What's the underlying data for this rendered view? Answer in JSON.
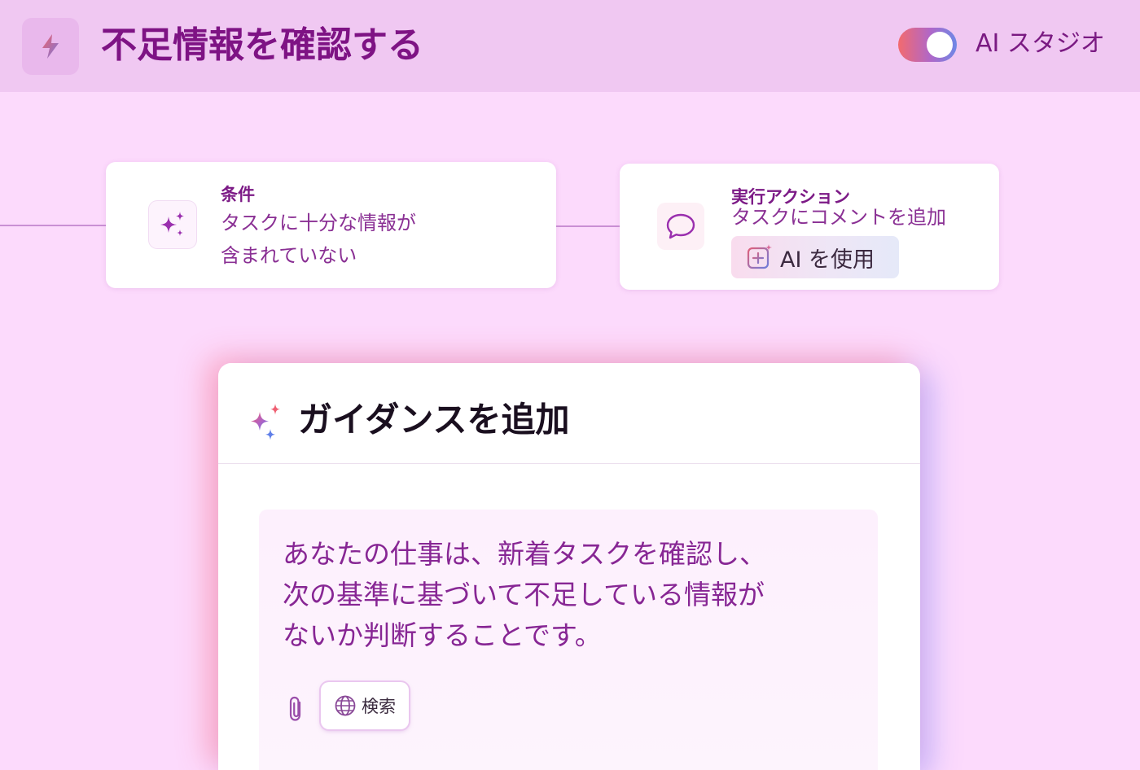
{
  "header": {
    "title": "不足情報を確認する",
    "app_icon": "lightning-icon",
    "toggle_on": true,
    "toggle_label": "AI スタジオ"
  },
  "condition_card": {
    "icon": "sparkle-icon",
    "heading": "条件",
    "text_line1": "タスクに十分な情報が",
    "text_line2": "含まれていない"
  },
  "action_card": {
    "icon": "comment-icon",
    "heading": "実行アクション",
    "text": "タスクにコメントを追加",
    "ai_button_label": "AI を使用",
    "ai_button_icon": "add-sparkle-icon"
  },
  "guidance": {
    "icon": "sparkle-gradient-icon",
    "title": "ガイダンスを追加",
    "prompt_line1": "あなたの仕事は、新着タスクを確認し、",
    "prompt_line2": "次の基準に基づいて不足している情報が",
    "prompt_line3": "ないか判断することです。",
    "attach_icon": "paperclip-icon",
    "search_label": "検索",
    "search_icon": "globe-icon"
  },
  "colors": {
    "background": "#fcdafc",
    "header_bg": "#f0c8f2",
    "title": "#7e1384",
    "accent_text": "#872694"
  }
}
